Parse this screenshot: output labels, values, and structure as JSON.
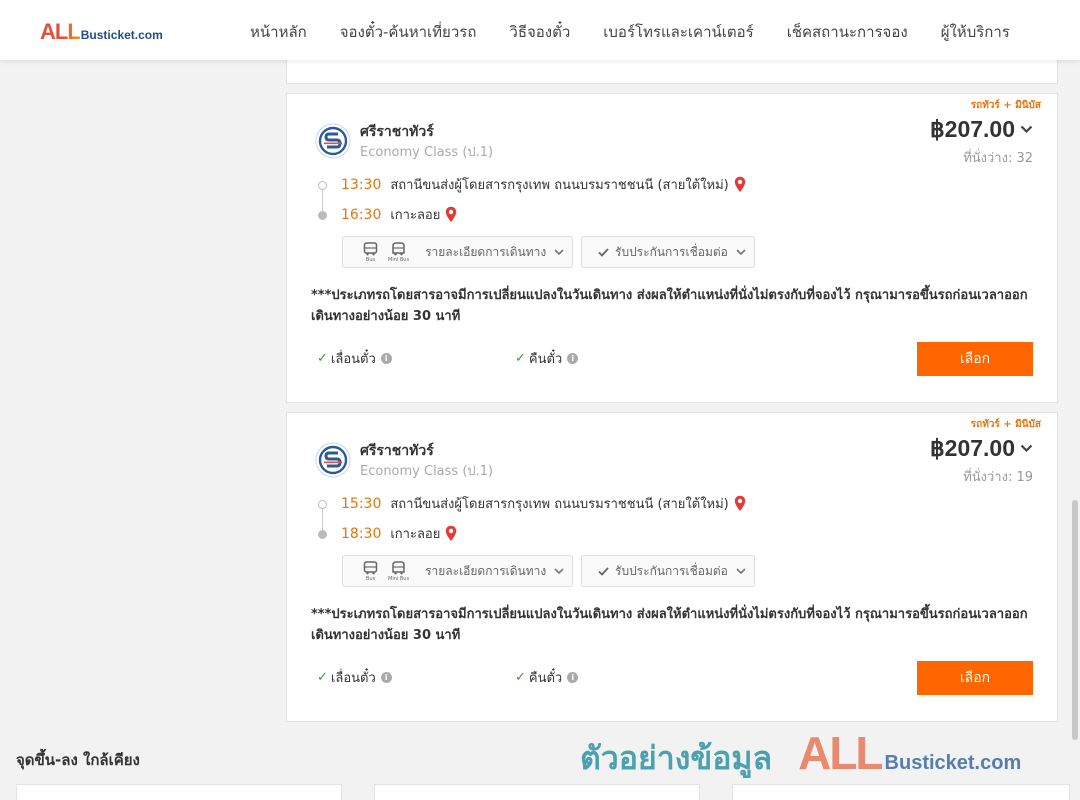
{
  "header": {
    "logo_all": "ALL",
    "logo_domain": "Busticket.com",
    "nav": [
      "หน้าหลัก",
      "จองตั๋ว-ค้นหาเที่ยวรถ",
      "วิธีจองตั๋ว",
      "เบอร์โทรและเคาน์เตอร์",
      "เช็คสถานะการจอง",
      "ผู้ให้บริการ"
    ]
  },
  "trips": [
    {
      "type_tag": "รถทัวร์ + มินิบัส",
      "operator": "ศรีราชาทัวร์",
      "class": "Economy Class (ป.1)",
      "price": "฿207.00",
      "seats": "ที่นั่งว่าง: 32",
      "depart_time": "13:30",
      "depart_place": "สถานีขนส่งผู้โดยสารกรุงเทพ ถนนบรมราชชนนี (สายใต้ใหม่)",
      "arrive_time": "16:30",
      "arrive_place": "เกาะลอย",
      "bus_label": "Bus",
      "minibus_label": "Mini Bus",
      "details_label": "รายละเอียดการเดินทาง",
      "connection_label": "รับประกันการเชื่อมต่อ",
      "note": "***ประเภทรถโดยสารอาจมีการเปลี่ยนแปลงในวันเดินทาง ส่งผลให้ตำแหน่งที่นั่งไม่ตรงกับที่จองไว้ กรุณามารอขึ้นรถก่อนเวลาออกเดินทางอย่างน้อย 30 นาที",
      "reschedule_label": "เลื่อนตั๋ว",
      "refund_label": "คืนตั๋ว",
      "select_label": "เลือก"
    },
    {
      "type_tag": "รถทัวร์ + มินิบัส",
      "operator": "ศรีราชาทัวร์",
      "class": "Economy Class (ป.1)",
      "price": "฿207.00",
      "seats": "ที่นั่งว่าง: 19",
      "depart_time": "15:30",
      "depart_place": "สถานีขนส่งผู้โดยสารกรุงเทพ ถนนบรมราชชนนี (สายใต้ใหม่)",
      "arrive_time": "18:30",
      "arrive_place": "เกาะลอย",
      "bus_label": "Bus",
      "minibus_label": "Mini Bus",
      "details_label": "รายละเอียดการเดินทาง",
      "connection_label": "รับประกันการเชื่อมต่อ",
      "note": "***ประเภทรถโดยสารอาจมีการเปลี่ยนแปลงในวันเดินทาง ส่งผลให้ตำแหน่งที่นั่งไม่ตรงกับที่จองไว้ กรุณามารอขึ้นรถก่อนเวลาออกเดินทางอย่างน้อย 30 นาที",
      "reschedule_label": "เลื่อนตั๋ว",
      "refund_label": "คืนตั๋ว",
      "select_label": "เลือก"
    }
  ],
  "nearby": {
    "title": "จุดขึ้น-ลง ใกล้เคียง"
  },
  "watermark": {
    "text": "ตัวอย่างข้อมูล",
    "all": "ALL",
    "domain": "Busticket.com"
  },
  "colors": {
    "accent": "#ff6600",
    "time": "#e8740c",
    "pin": "#e53935",
    "check": "#3c9a3c",
    "logo_red": "#e84c3d",
    "logo_orange": "#f39c12"
  }
}
